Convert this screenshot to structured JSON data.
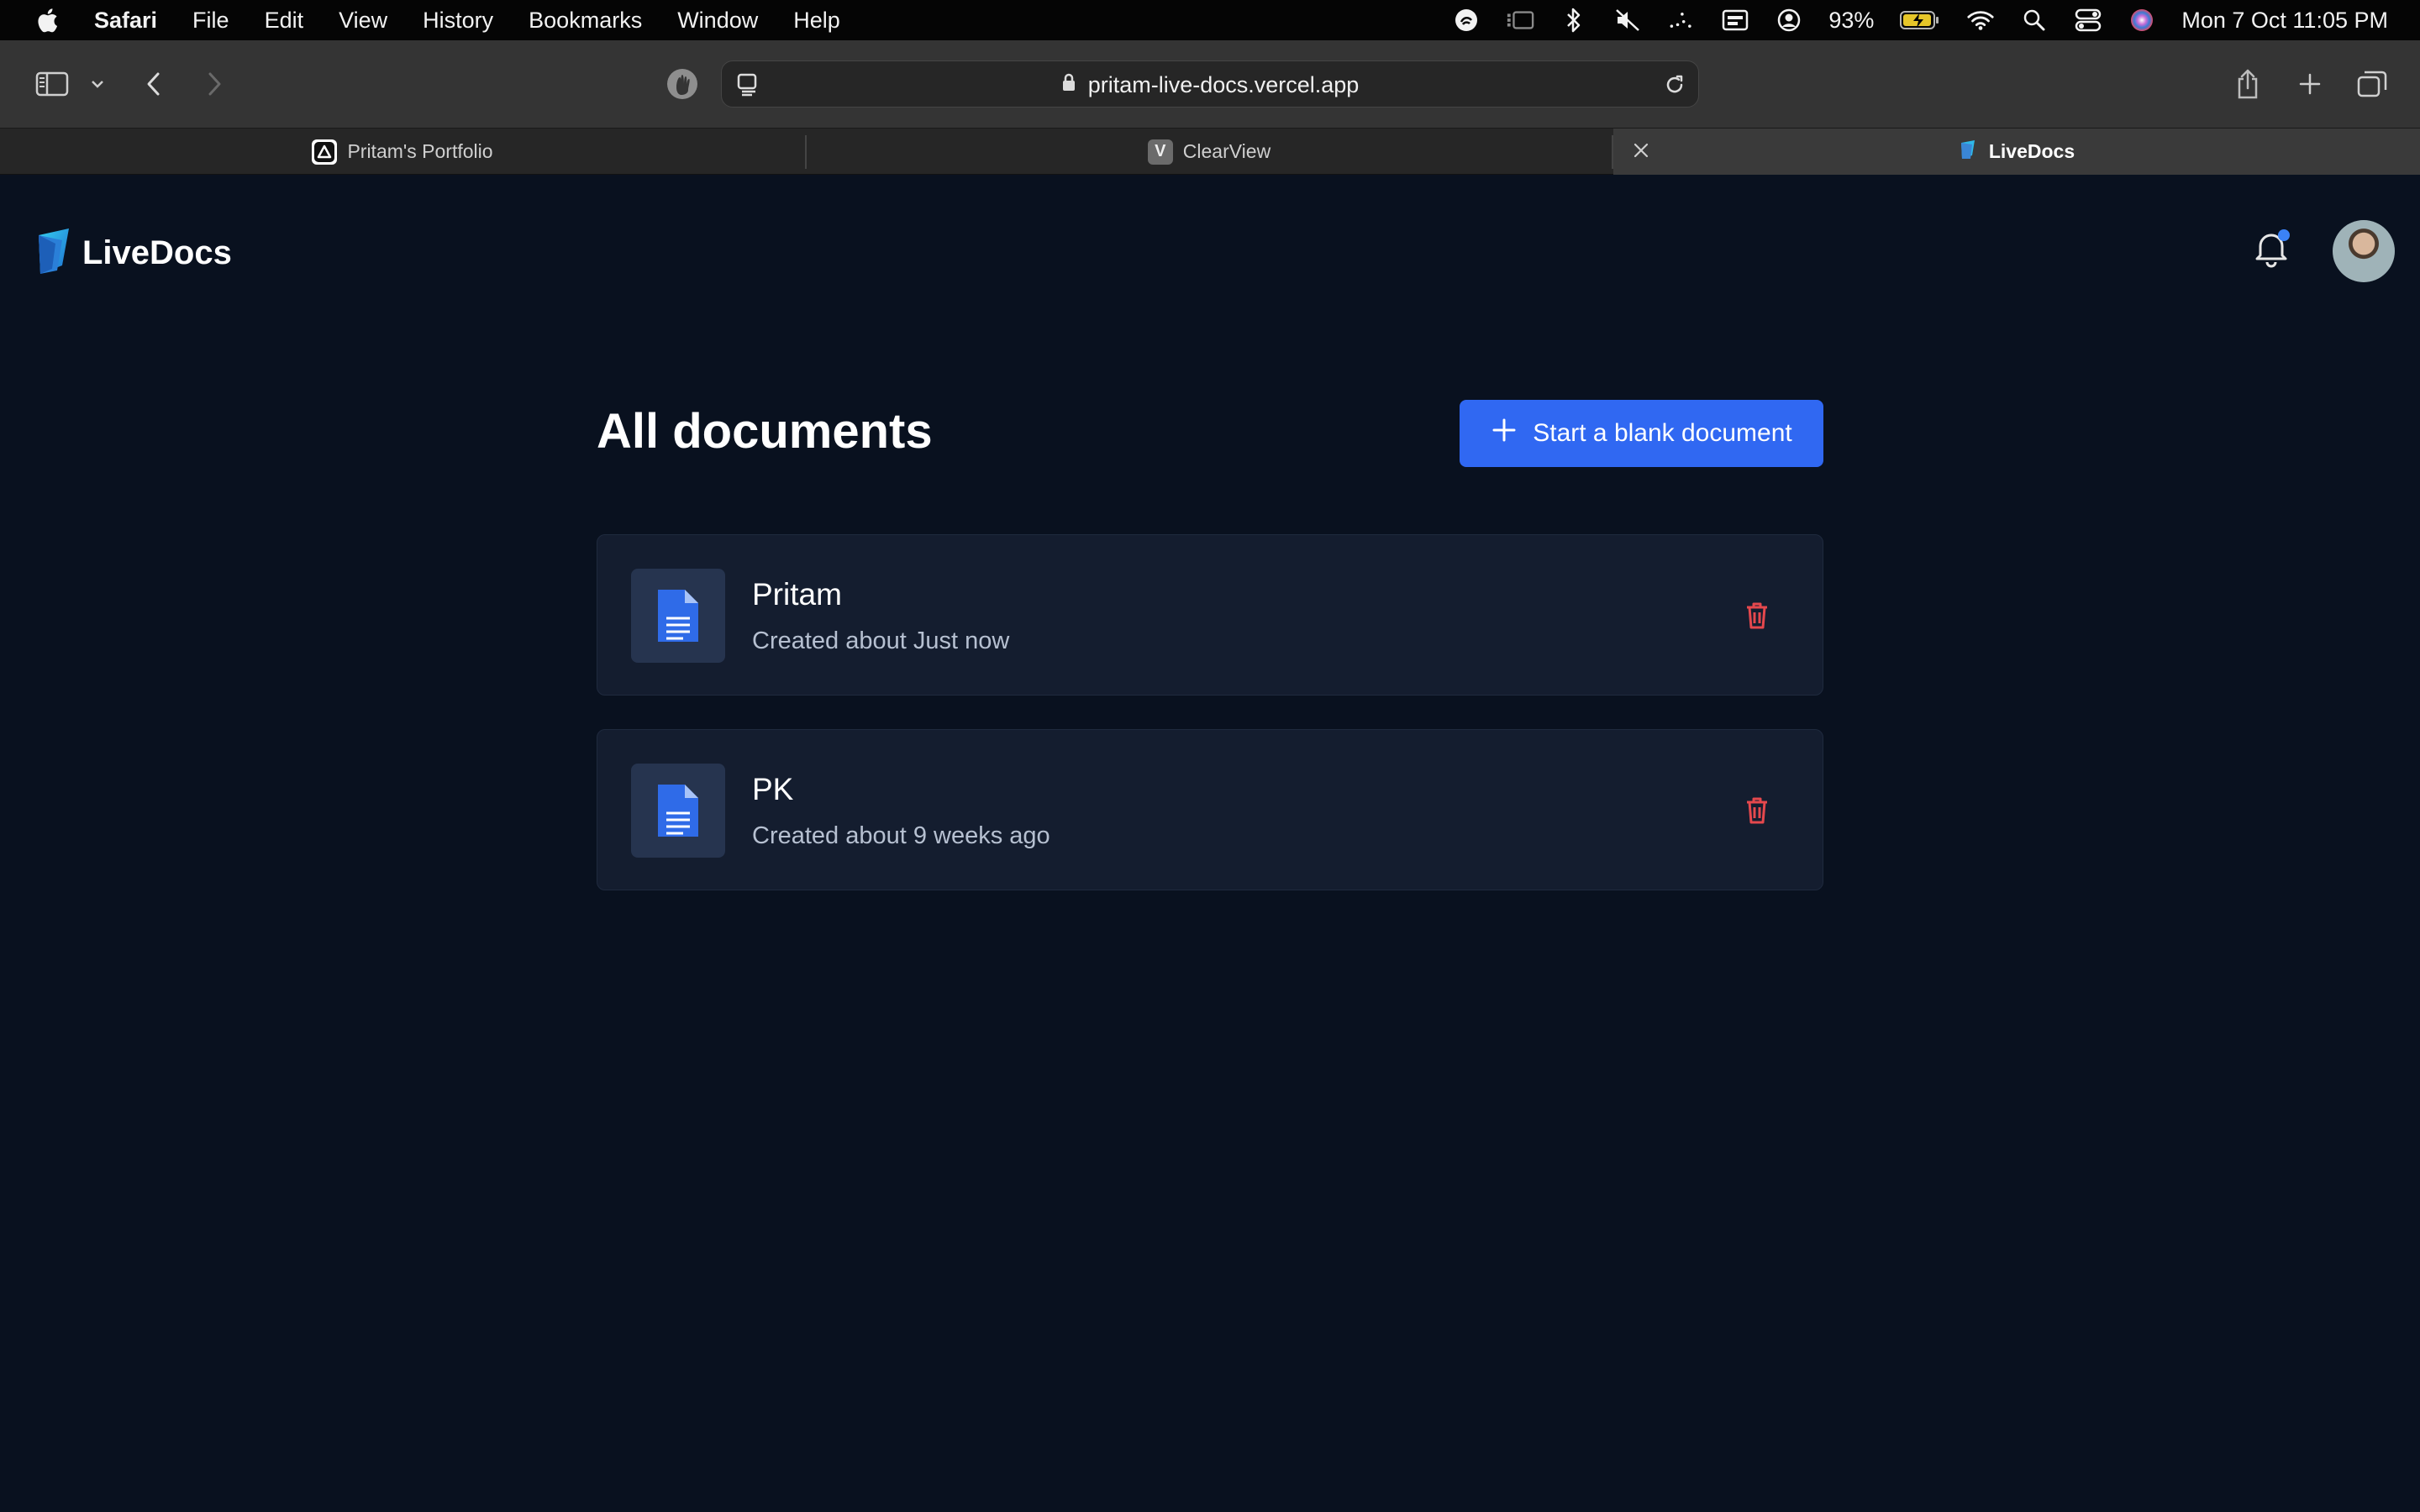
{
  "menubar": {
    "app_name": "Safari",
    "items": [
      "File",
      "Edit",
      "View",
      "History",
      "Bookmarks",
      "Window",
      "Help"
    ],
    "battery": "93%",
    "datetime": "Mon 7 Oct  11:05 PM"
  },
  "browser": {
    "url": "pritam-live-docs.vercel.app",
    "tabs": [
      {
        "title": "Pritam's Portfolio"
      },
      {
        "title": "ClearView",
        "favicon_letter": "V"
      },
      {
        "title": "LiveDocs",
        "active": true
      }
    ]
  },
  "app": {
    "brand": "LiveDocs",
    "page_title": "All documents",
    "new_doc_label": "Start a blank document",
    "documents": [
      {
        "name": "Pritam",
        "created": "Created about Just now"
      },
      {
        "name": "PK",
        "created": "Created about 9 weeks ago"
      }
    ]
  },
  "colors": {
    "background": "#09111f",
    "card": "#141d2f",
    "accent_blue": "#3068f2",
    "delete_red": "#e5484d",
    "notification_dot": "#3b82f6"
  }
}
